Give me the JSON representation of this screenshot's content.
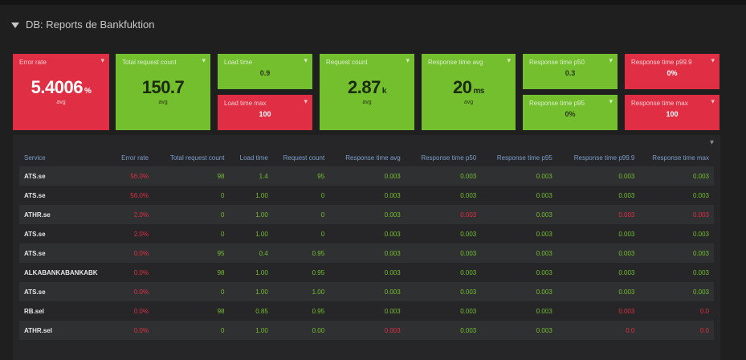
{
  "row": {
    "title": "DB: Reports de Bankfuktion"
  },
  "panels": [
    {
      "id": "p1",
      "title": "Error rate",
      "value": "5.4006",
      "unit": "%",
      "sub": "avg",
      "color": "red"
    },
    {
      "id": "p2",
      "title": "Total request count",
      "value": "150.7",
      "unit": "",
      "sub": "avg",
      "color": "green"
    },
    {
      "id": "p3a",
      "title": "Load time",
      "value": "0.9",
      "color": "green"
    },
    {
      "id": "p3b",
      "title": "Load time max",
      "value": "100",
      "color": "red"
    },
    {
      "id": "p4",
      "title": "Request count",
      "value": "2.87",
      "unit": "k",
      "sub": "avg",
      "color": "green"
    },
    {
      "id": "p5",
      "title": "Response time avg",
      "value": "20",
      "unit": "ms",
      "sub": "avg",
      "color": "green"
    },
    {
      "id": "p6a",
      "title": "Response time p50",
      "value": "0.3",
      "color": "green"
    },
    {
      "id": "p6b",
      "title": "Response time p95",
      "value": "0%",
      "color": "green"
    },
    {
      "id": "p7a",
      "title": "Response time p99.9",
      "value": "0%",
      "color": "red"
    },
    {
      "id": "p7b",
      "title": "Response time max",
      "value": "100",
      "color": "red"
    }
  ],
  "table": {
    "headers": [
      "Service",
      "Error rate",
      "Total request count",
      "Load time",
      "Request count",
      "Response time avg",
      "Response time p50",
      "Response time p95",
      "Response time p99.9",
      "Response time max"
    ],
    "rows": [
      [
        "ATS.se",
        "56.0%",
        "98",
        "1.4",
        "95",
        "0.003",
        "0.003",
        "0.003",
        "0.003",
        "0.003"
      ],
      [
        "ATS.se",
        "56.0%",
        "0",
        "1.00",
        "0",
        "0.003",
        "0.003",
        "0.003",
        "0.003",
        "0.003"
      ],
      [
        "ATHR.se",
        "2.0%",
        "0",
        "1.00",
        "0",
        "0.003",
        "0.003",
        "0.003",
        "0.003",
        "0.003"
      ],
      [
        "ATS.se",
        "2.0%",
        "0",
        "1.00",
        "0",
        "0.003",
        "0.003",
        "0.003",
        "0.003",
        "0.003"
      ],
      [
        "ATS.se",
        "0.0%",
        "95",
        "0.4",
        "0.95",
        "0.003",
        "0.003",
        "0.003",
        "0.003",
        "0.003"
      ],
      [
        "ALKABANKABANKABK",
        "0.0%",
        "98",
        "1.00",
        "0.95",
        "0.003",
        "0.003",
        "0.003",
        "0.003",
        "0.003"
      ],
      [
        "ATS.se",
        "0.0%",
        "0",
        "1.00",
        "1.00",
        "0.003",
        "0.003",
        "0.003",
        "0.003",
        "0.003"
      ],
      [
        "RB.sel",
        "0.0%",
        "98",
        "0.85",
        "0.95",
        "0.003",
        "0.003",
        "0.003",
        "0.003",
        "0.0"
      ],
      [
        "ATHR.sel",
        "0.0%",
        "0",
        "1.00",
        "0.00",
        "0.003",
        "0.003",
        "0.003",
        "0.0",
        "0.0"
      ]
    ],
    "cellColors": [
      [
        "",
        "red",
        "green",
        "green",
        "green",
        "green",
        "green",
        "green",
        "green",
        "green"
      ],
      [
        "",
        "red",
        "green",
        "green",
        "green",
        "green",
        "green",
        "green",
        "green",
        "green"
      ],
      [
        "",
        "red",
        "green",
        "green",
        "green",
        "green",
        "red",
        "green",
        "red",
        "red"
      ],
      [
        "",
        "red",
        "green",
        "green",
        "green",
        "green",
        "green",
        "green",
        "green",
        "green"
      ],
      [
        "",
        "red",
        "green",
        "green",
        "green",
        "green",
        "green",
        "green",
        "green",
        "green"
      ],
      [
        "",
        "red",
        "green",
        "green",
        "green",
        "green",
        "green",
        "green",
        "green",
        "green"
      ],
      [
        "",
        "red",
        "green",
        "green",
        "green",
        "green",
        "green",
        "green",
        "green",
        "green"
      ],
      [
        "",
        "red",
        "green",
        "green",
        "green",
        "green",
        "green",
        "green",
        "red",
        "red"
      ],
      [
        "",
        "red",
        "green",
        "green",
        "green",
        "red",
        "green",
        "green",
        "red",
        "red"
      ]
    ]
  },
  "colors": {
    "red": "#e02f44",
    "green": "#73bf2e",
    "background": "#1f1f20"
  }
}
